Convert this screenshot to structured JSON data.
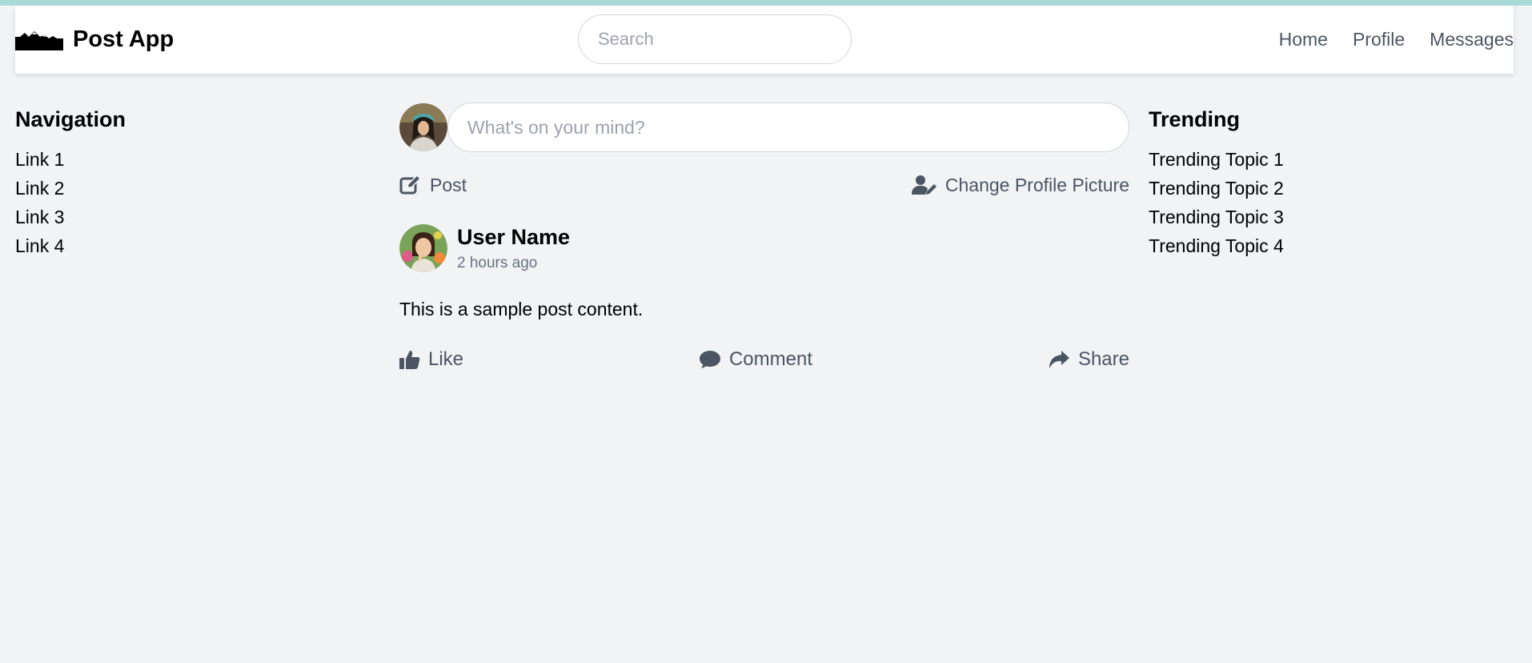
{
  "app": {
    "title": "Post App"
  },
  "header": {
    "search_placeholder": "Search",
    "nav": [
      "Home",
      "Profile",
      "Messages"
    ]
  },
  "left": {
    "title": "Navigation",
    "links": [
      "Link 1",
      "Link 2",
      "Link 3",
      "Link 4"
    ]
  },
  "composer": {
    "placeholder": "What's on your mind?",
    "post_label": "Post",
    "change_picture_label": "Change Profile Picture"
  },
  "post": {
    "user": "User Name",
    "time": "2 hours ago",
    "content": "This is a sample post content.",
    "like_label": "Like",
    "comment_label": "Comment",
    "share_label": "Share"
  },
  "right": {
    "title": "Trending",
    "topics": [
      "Trending Topic 1",
      "Trending Topic 2",
      "Trending Topic 3",
      "Trending Topic 4"
    ]
  },
  "icons": {
    "logo": "mountain-logo-icon",
    "post": "pen-to-square-icon",
    "change_picture": "user-pen-icon",
    "like": "thumbs-up-icon",
    "comment": "comment-bubble-icon",
    "share": "share-arrow-icon"
  },
  "colors": {
    "background": "#f2f3f5",
    "header": "#ffffff",
    "accent_strip": "#a9d9d9",
    "muted_text": "#4b5563"
  }
}
